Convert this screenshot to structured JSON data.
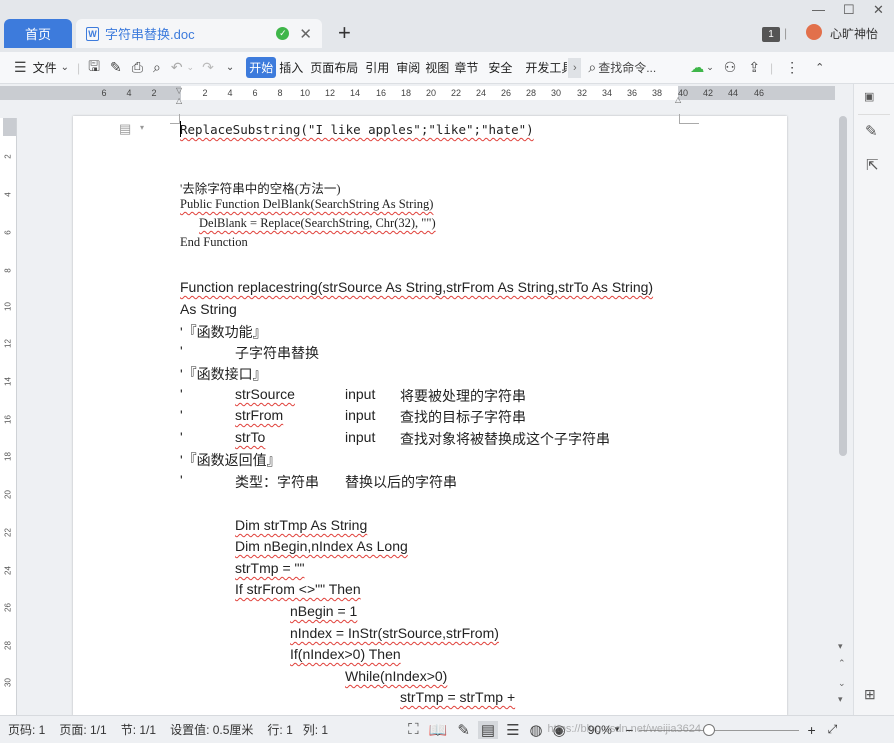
{
  "window": {
    "home_tab": "首页",
    "doc_tab_title": "字符串替换.doc",
    "tab_count": "1",
    "user_name": "心旷神怡"
  },
  "toolbar": {
    "file_menu": "文件",
    "tabs": [
      "开始",
      "插入",
      "页面布局",
      "引用",
      "审阅",
      "视图",
      "章节",
      "安全",
      "开发工具"
    ],
    "search_label": "查找命令..."
  },
  "ruler": {
    "labels": [
      "6",
      "4",
      "2",
      "2",
      "4",
      "6",
      "8",
      "10",
      "12",
      "14",
      "16",
      "18",
      "20",
      "22",
      "24",
      "26",
      "28",
      "30",
      "32",
      "34",
      "36",
      "38",
      "40",
      "42",
      "44",
      "46"
    ],
    "v_labels": [
      "2",
      "4",
      "6",
      "8",
      "10",
      "12",
      "14",
      "16",
      "18",
      "20",
      "22",
      "24",
      "26",
      "28",
      "30"
    ]
  },
  "document": {
    "line01": "ReplaceSubstring(\"I like apples\";\"like\";\"hate\")",
    "line02": "'去除字符串中的空格(方法一)",
    "line03": "Public Function DelBlank(SearchString As String)",
    "line04": "DelBlank = Replace(SearchString, Chr(32), \"\")",
    "line05": "End Function",
    "line06": "Function replacestring(strSource As String,strFrom As String,strTo As String)",
    "line07": "As String",
    "line08": "'『函数功能』",
    "line09a": "'",
    "line09b": "子字符串替换",
    "line10": "'『函数接口』",
    "line11": [
      "'",
      "strSource",
      "input",
      "将要被处理的字符串"
    ],
    "line12": [
      "'",
      "strFrom",
      "input",
      "查找的目标子字符串"
    ],
    "line13": [
      "'",
      "strTo",
      "input",
      "查找对象将被替换成这个子字符串"
    ],
    "line14": "'『函数返回值』",
    "line15": [
      "'",
      "类型：字符串",
      "替换以后的字符串"
    ],
    "line16": "Dim strTmp As String",
    "line17": "Dim nBegin,nIndex As Long",
    "line18": "strTmp = \"\"",
    "line19": "If strFrom <>\"\" Then",
    "line20": "nBegin = 1",
    "line21": "nIndex = InStr(strSource,strFrom)",
    "line22": "If(nIndex>0) Then",
    "line23": "While(nIndex>0)",
    "line24": "strTmp = strTmp +"
  },
  "status": {
    "page_num": "页码: 1",
    "page_count": "页面: 1/1",
    "section": "节: 1/1",
    "setting": "设置值: 0.5厘米",
    "row": "行: 1",
    "col": "列: 1",
    "zoom": "90%",
    "watermark": "https://blog.csdn.net/weijia3624"
  }
}
